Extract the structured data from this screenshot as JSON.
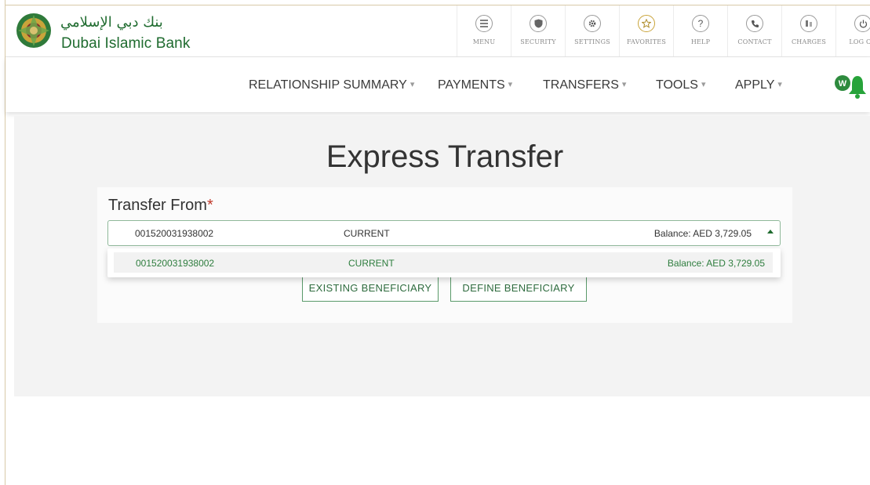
{
  "brand": {
    "name_ar": "بنك دبي الإسلامي",
    "name_en": "Dubai Islamic Bank",
    "color": "#1f6b2f"
  },
  "toolbar": [
    {
      "label": "MENU",
      "icon": "menu-icon"
    },
    {
      "label": "SECURITY",
      "icon": "shield-icon"
    },
    {
      "label": "SETTINGS",
      "icon": "gear-icon"
    },
    {
      "label": "FAVORITES",
      "icon": "star-icon"
    },
    {
      "label": "HELP",
      "icon": "help-icon"
    },
    {
      "label": "CONTACT",
      "icon": "phone-icon"
    },
    {
      "label": "CHARGES",
      "icon": "charges-icon"
    },
    {
      "label": "LOG OU",
      "icon": "power-icon"
    }
  ],
  "nav": [
    {
      "label": "RELATIONSHIP SUMMARY"
    },
    {
      "label": "PAYMENTS"
    },
    {
      "label": "TRANSFERS"
    },
    {
      "label": "TOOLS"
    },
    {
      "label": "APPLY"
    }
  ],
  "page": {
    "title": "Express Transfer",
    "transfer_from_label": "Transfer From",
    "required_mark": "*"
  },
  "select": {
    "account": "001520031938002",
    "type": "CURRENT",
    "balance": "Balance: AED 3,729.05"
  },
  "options": [
    {
      "account": "001520031938002",
      "type": "CURRENT",
      "balance": "Balance:  AED 3,729.05"
    }
  ],
  "buttons": {
    "existing": "EXISTING BENEFICIARY",
    "define": "DEFINE BENEFICIARY"
  }
}
